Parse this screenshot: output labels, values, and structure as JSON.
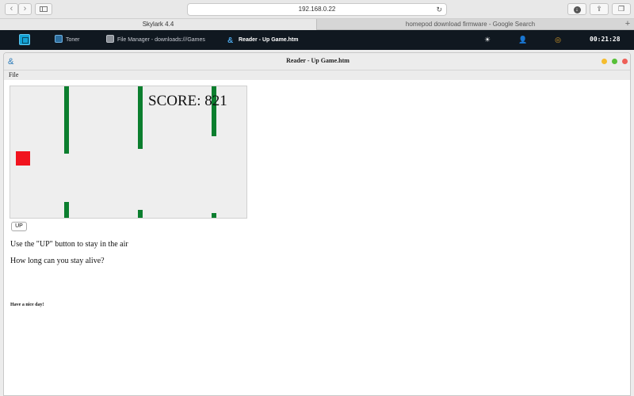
{
  "browser": {
    "back_icon": "chevron-left-icon",
    "forward_icon": "chevron-right-icon",
    "sidebar_icon": "sidebar-icon",
    "address": "192.168.0.22",
    "reload_icon": "reload-icon",
    "download_icon": "download-icon",
    "share_icon": "share-icon",
    "tabs_icon": "tabs-icon",
    "tabs": [
      {
        "label": "Skylark 4.4",
        "active": true
      },
      {
        "label": "homepod download firmware - Google Search",
        "active": false
      }
    ],
    "new_tab_icon": "plus-icon"
  },
  "taskbar": {
    "start_icon": "start-menu-icon",
    "items": [
      {
        "label": "Toner",
        "icon": "toner-icon",
        "active": false
      },
      {
        "label": "File Manager - downloads:///Games",
        "icon": "file-manager-icon",
        "active": false
      },
      {
        "label": "Reader - Up Game.htm",
        "icon": "reader-icon",
        "active": true
      }
    ],
    "tray": [
      "brightness-icon",
      "user-icon",
      "search-icon"
    ],
    "clock": "00:21:28"
  },
  "window": {
    "title": "Reader - Up Game.htm",
    "menu": {
      "file": "File"
    },
    "colors": {
      "close": "#ee5f57",
      "minimize": "#f5bd2f",
      "maximize": "#57c038"
    }
  },
  "game": {
    "score_label": "SCORE: 821",
    "score": 821,
    "colors": {
      "background": "#eeeeee",
      "pipe": "#0b7e2e",
      "player": "#f1131e"
    },
    "up_button": "UP",
    "instructions": "Use the \"UP\" button to stay in the air",
    "question": "How long can you stay alive?",
    "footer": "Have a nice day!"
  }
}
